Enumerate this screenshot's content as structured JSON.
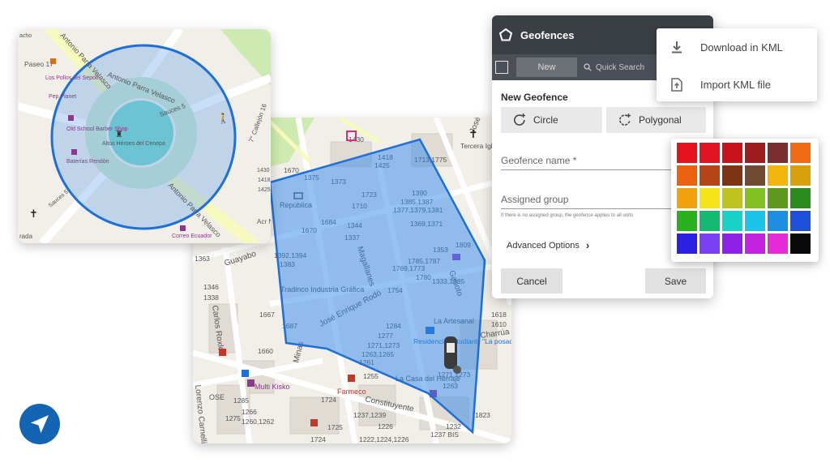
{
  "panel": {
    "title": "Geofences",
    "new_label": "New",
    "search_placeholder": "Quick Search",
    "section_title": "New Geofence",
    "circle_label": "Circle",
    "polygonal_label": "Polygonal",
    "name_placeholder": "Geofence name *",
    "group_placeholder": "Assigned group",
    "group_hint": "If there is no assigned group, the geofence applies to all units",
    "advanced_label": "Advanced Options",
    "cancel_label": "Cancel",
    "save_label": "Save"
  },
  "kml_menu": {
    "download_label": "Download in KML",
    "import_label": "Import KML file"
  },
  "palette": {
    "colors": [
      "#e8121c",
      "#e0141f",
      "#c8131c",
      "#9b1c1f",
      "#7a2e2e",
      "#ef6a12",
      "#e8620f",
      "#b54516",
      "#7c3412",
      "#6e4a33",
      "#f3b40c",
      "#d8a10a",
      "#f2a20e",
      "#f7e51a",
      "#c2c41e",
      "#82c11f",
      "#5c9a1c",
      "#2a8c1c",
      "#29b11f",
      "#14b972",
      "#1ad1c8",
      "#1ac4e6",
      "#1e8fe0",
      "#1e4fd8",
      "#2a22e0",
      "#7a3ff0",
      "#8b22e6",
      "#c222e0",
      "#e62ad6",
      "#0a0a0a"
    ]
  },
  "map_round": {
    "streets": [
      "Antonio Parra Velasco",
      "Antonio Parra Velasco",
      "Antonio Parra Velasco",
      "Paseo 17",
      "7° Callejón 16",
      "Sauces 5",
      "Sauces 5",
      "Acr Naval Co",
      "rada"
    ],
    "pois": [
      "Los Pollos del Sepoll",
      "Pep Planet",
      "Old School Barber Shop",
      "Altos Héroes del Cenepa",
      "Baterías Rendón",
      "Correo Ecuador",
      "acho"
    ],
    "numbers": [
      "1430",
      "1418",
      "1425"
    ]
  },
  "map_big": {
    "streets": [
      "Guayabo",
      "Magallanes",
      "José Enrique Rodó",
      "Gaboto",
      "José Arsmendi",
      "Carlos Roxlo",
      "Minas",
      "Lorenzo Carnelli",
      "Constituyente",
      "Charrúa"
    ],
    "pois": [
      "República",
      "Tradinco Industria Gráfica",
      "La Artesanal",
      "Residencia estudiantil \"La posada\"",
      "La Casa del Herraje",
      "Multi Kisko",
      "Farmeco",
      "Tercera Iglesia de Cristo Científico",
      "OSE"
    ],
    "numbers": [
      "1670",
      "1375",
      "1373",
      "1723",
      "1710",
      "1684",
      "1344",
      "1337",
      "1670",
      "1390",
      "1385,1387",
      "1377,1379,1381",
      "1369,1371",
      "1353",
      "1809",
      "1785,1787",
      "1769,1773",
      "1780",
      "1333,1335",
      "1754",
      "1392,1394",
      "1383",
      "1346",
      "1338",
      "1363",
      "1667",
      "1687",
      "1660",
      "1284",
      "1277",
      "1271,1273",
      "1263,1265",
      "1261",
      "1271,1273",
      "1263",
      "1255",
      "1618",
      "1610",
      "1285",
      "1724",
      "1275",
      "1266",
      "1260,1262",
      "1237,1239",
      "1725",
      "1226",
      "1232",
      "1724",
      "1222,1224,1226",
      "1237 BIS",
      "1823",
      "1713,1775",
      "1430",
      "1418",
      "1425"
    ]
  }
}
